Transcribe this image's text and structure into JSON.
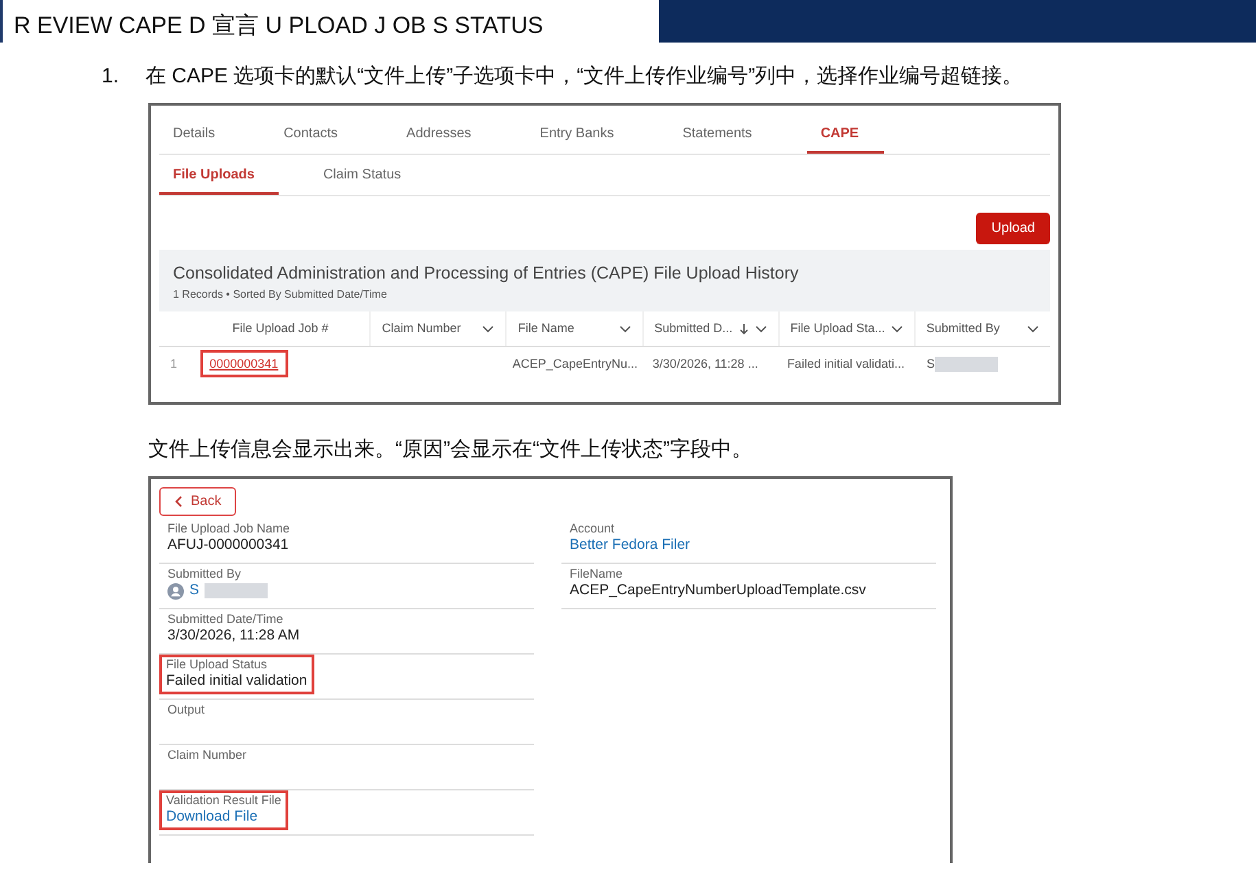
{
  "header": {
    "title": "R EVIEW CAPE D 宣言 U PLOAD J OB S STATUS"
  },
  "steps": [
    {
      "number": "1.",
      "text": "在 CAPE 选项卡的默认“文件上传”子选项卡中，“文件上传作业编号”列中，选择作业编号超链接。"
    }
  ],
  "screenshot_1": {
    "tabs": [
      {
        "label": "Details",
        "selected": false
      },
      {
        "label": "Contacts",
        "selected": false
      },
      {
        "label": "Addresses",
        "selected": false
      },
      {
        "label": "Entry Banks",
        "selected": false
      },
      {
        "label": "Statements",
        "selected": false
      },
      {
        "label": "CAPE",
        "selected": true
      }
    ],
    "subtabs": [
      {
        "label": "File Uploads",
        "selected": true
      },
      {
        "label": "Claim Status",
        "selected": false
      }
    ],
    "upload_button": "Upload",
    "panel": {
      "title": "Consolidated Administration and Processing of Entries (CAPE) File Upload History",
      "subtitle": "1 Records • Sorted By Submitted Date/Time"
    },
    "table": {
      "columns": [
        {
          "label": "File Upload Job #",
          "menu": false,
          "sorted": false
        },
        {
          "label": "Claim Number",
          "menu": true,
          "sorted": false
        },
        {
          "label": "File Name",
          "menu": true,
          "sorted": false
        },
        {
          "label": "Submitted D...",
          "menu": true,
          "sorted": true
        },
        {
          "label": "File Upload Sta...",
          "menu": true,
          "sorted": false
        },
        {
          "label": "Submitted By",
          "menu": true,
          "sorted": false
        }
      ],
      "rows": [
        {
          "row_number": "1",
          "job": "0000000341",
          "job_highlighted": true,
          "file_name": "ACEP_CapeEntryNu...",
          "submitted": "3/30/2026, 11:28 ...",
          "status": "Failed initial validati...",
          "submitted_by": "S"
        }
      ]
    }
  },
  "paragraph": "文件上传信息会显示出来。“原因”会显示在“文件上传状态”字段中。",
  "screenshot_2": {
    "back_button": "Back",
    "left_fields": [
      {
        "label": "File Upload Job Name",
        "value": "AFUJ-0000000341",
        "kind": "text",
        "highlighted": false
      },
      {
        "label": "Submitted By",
        "value": "S",
        "kind": "user",
        "highlighted": false
      },
      {
        "label": "Submitted Date/Time",
        "value": "3/30/2026, 11:28 AM",
        "kind": "text",
        "highlighted": false
      },
      {
        "label": "File Upload Status",
        "value": "Failed initial validation",
        "kind": "text",
        "highlighted": true
      },
      {
        "label": "Output",
        "highlighted": false
      },
      {
        "label": "Claim Number",
        "highlighted": false
      },
      {
        "label": "Validation Result File",
        "value": "Download File",
        "kind": "link",
        "highlighted": true
      }
    ],
    "right_fields": [
      {
        "label": "Account",
        "value": "Better Fedora Filer",
        "kind": "link",
        "highlighted": false
      },
      {
        "label": "FileName",
        "value": "ACEP_CapeEntryNumberUploadTemplate.csv",
        "kind": "text",
        "highlighted": false
      }
    ]
  }
}
